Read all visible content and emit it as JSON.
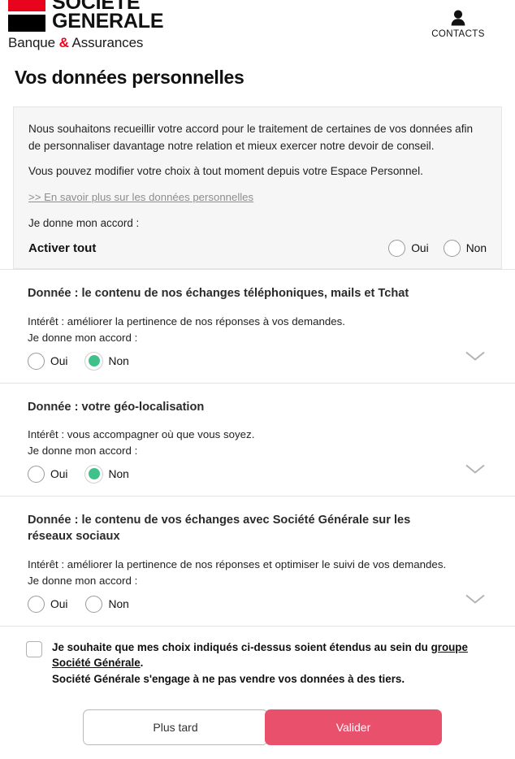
{
  "header": {
    "logo": {
      "line1": "SOCIETE",
      "line2": "GENERALE",
      "tagline_before": "Banque ",
      "tagline_amp": "&",
      "tagline_after": " Assurances",
      "red": "#e9041e",
      "black": "#000000"
    },
    "contacts_label": "CONTACTS",
    "contacts_icon": "person-icon"
  },
  "page_title": "Vos données personnelles",
  "intro": {
    "paragraph1": "Nous souhaitons recueillir votre accord pour le traitement de certaines de vos données afin de personnaliser davantage notre relation et mieux exercer notre devoir de conseil.",
    "paragraph2": "Vous pouvez modifier votre choix à tout moment depuis votre Espace Personnel.",
    "more_link": ">> En savoir plus sur les données personnelles",
    "consent_label": "Je donne mon accord :",
    "activate_all_label": "Activer tout",
    "yes_label": "Oui",
    "no_label": "Non",
    "yes_selected": false,
    "no_selected": false,
    "background": "#f6f6f6"
  },
  "sections": [
    {
      "title": "Donnée : le contenu de nos échanges téléphoniques, mails et Tchat",
      "interest": "Intérêt : améliorer la pertinence de nos réponses à vos demandes.",
      "consent_label": "Je donne mon accord :",
      "yes_label": "Oui",
      "no_label": "Non",
      "selected": "Non",
      "expand_icon": "chevron-down-icon"
    },
    {
      "title": "Donnée : votre géo-localisation",
      "interest": "Intérêt : vous accompagner où que vous soyez.",
      "consent_label": "Je donne mon accord :",
      "yes_label": "Oui",
      "no_label": "Non",
      "selected": "Non",
      "expand_icon": "chevron-down-icon"
    },
    {
      "title": "Donnée : le contenu de vos échanges avec Société Générale sur les réseaux sociaux",
      "interest": "Intérêt : améliorer la pertinence de nos réponses et optimiser le suivi de vos demandes.",
      "consent_label": "Je donne mon accord :",
      "yes_label": "Oui",
      "no_label": "Non",
      "selected": "",
      "expand_icon": "chevron-down-icon"
    }
  ],
  "extend": {
    "checked": false,
    "text_before": "Je souhaite que mes choix indiqués ci-dessus soient étendus au sein du ",
    "link_text": "groupe Société Générale",
    "text_after": ".",
    "line2": "Société Générale s'engage à ne pas vendre vos données à des tiers."
  },
  "footer": {
    "later_label": "Plus tard",
    "validate_label": "Valider",
    "validate_color": "#e8506b"
  },
  "colors": {
    "selected_radio_green": "#40c18a",
    "brand_red": "#e9041e",
    "accent_pink": "#e8506b"
  }
}
